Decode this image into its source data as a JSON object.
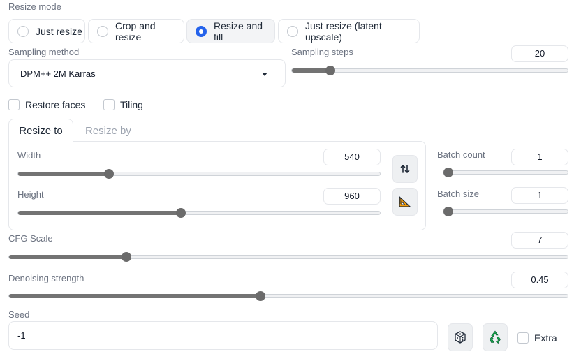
{
  "resize_mode": {
    "label": "Resize mode",
    "options": [
      "Just resize",
      "Crop and resize",
      "Resize and fill",
      "Just resize (latent upscale)"
    ],
    "selected_index": 2
  },
  "sampling_method": {
    "label": "Sampling method",
    "value": "DPM++ 2M Karras"
  },
  "sampling_steps": {
    "label": "Sampling steps",
    "value": "20",
    "fraction": 0.14
  },
  "checkboxes": {
    "restore_faces": "Restore faces",
    "tiling": "Tiling"
  },
  "tabs": {
    "resize_to": "Resize to",
    "resize_by": "Resize by"
  },
  "width": {
    "label": "Width",
    "value": "540",
    "fraction": 0.25
  },
  "height": {
    "label": "Height",
    "value": "960",
    "fraction": 0.45
  },
  "batch_count": {
    "label": "Batch count",
    "value": "1",
    "fraction": 0.0
  },
  "batch_size": {
    "label": "Batch size",
    "value": "1",
    "fraction": 0.0
  },
  "cfg_scale": {
    "label": "CFG Scale",
    "value": "7",
    "fraction": 0.21
  },
  "denoising_strength": {
    "label": "Denoising strength",
    "value": "0.45",
    "fraction": 0.45
  },
  "seed": {
    "label": "Seed",
    "value": "-1"
  },
  "extra": {
    "label": "Extra"
  },
  "icons": {
    "swap": "swap-dimensions-icon",
    "aspect": "aspect-ratio-ruler-icon",
    "dice": "dice-icon",
    "recycle": "recycle-icon"
  },
  "colors": {
    "accent": "#2563eb",
    "slider_fill": "#737373",
    "recycle": "#16a34a"
  }
}
